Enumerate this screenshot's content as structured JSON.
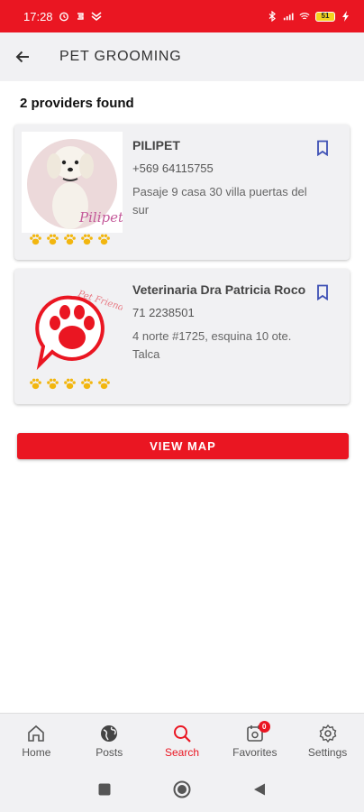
{
  "status_bar": {
    "time": "17:28",
    "battery": "51"
  },
  "header": {
    "title": "PET GROOMING",
    "back_icon": "arrow-left-icon"
  },
  "results": {
    "count_text": "2 providers found"
  },
  "providers": [
    {
      "name": "PILIPET",
      "phone": "+569 64115755",
      "address": "Pasaje 9 casa 30 villa puertas del sur",
      "rating": 5,
      "logo_text": "Pilipet"
    },
    {
      "name": "Veterinaria Dra Patricia Roco",
      "phone": "71 2238501",
      "address": "4 norte #1725, esquina 10 ote. Talca",
      "rating": 5,
      "logo_text": "Pet Friendly"
    }
  ],
  "actions": {
    "view_map": "VIEW MAP"
  },
  "bottom_nav": {
    "items": [
      {
        "label": "Home",
        "icon": "home-icon"
      },
      {
        "label": "Posts",
        "icon": "globe-icon"
      },
      {
        "label": "Search",
        "icon": "search-icon",
        "active": true
      },
      {
        "label": "Favorites",
        "icon": "favorites-icon",
        "badge": "0"
      },
      {
        "label": "Settings",
        "icon": "gear-icon"
      }
    ]
  },
  "colors": {
    "accent": "#ea1622",
    "paw_gold": "#f2b60f",
    "bookmark_blue": "#3f51b5",
    "surface": "#f1f1f3"
  }
}
